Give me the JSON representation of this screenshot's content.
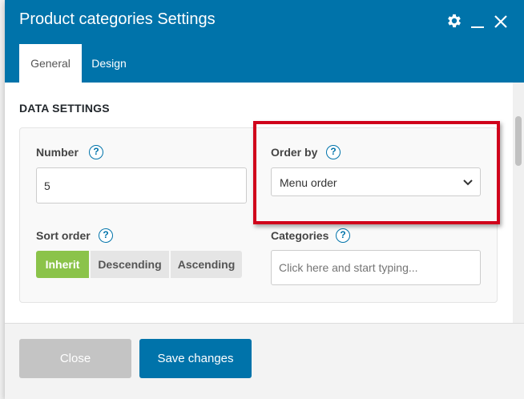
{
  "window": {
    "title": "Product categories Settings",
    "settings_icon": "gear-icon",
    "minimize_icon": "minimize-icon",
    "close_icon": "close-icon"
  },
  "tabs": [
    {
      "label": "General",
      "active": true
    },
    {
      "label": "Design",
      "active": false
    }
  ],
  "data_settings": {
    "section_title": "DATA SETTINGS",
    "number": {
      "label": "Number",
      "value": "5"
    },
    "order_by": {
      "label": "Order by",
      "selected": "Menu order"
    },
    "sort_order": {
      "label": "Sort order",
      "options": [
        "Inherit",
        "Descending",
        "Ascending"
      ],
      "selected": "Inherit"
    },
    "categories": {
      "label": "Categories",
      "placeholder": "Click here and start typing..."
    }
  },
  "help_symbol": "?",
  "footer": {
    "close_label": "Close",
    "save_label": "Save changes"
  },
  "colors": {
    "header": "#0073aa",
    "accent_green": "#8bc34a",
    "highlight_red": "#d0021b"
  }
}
